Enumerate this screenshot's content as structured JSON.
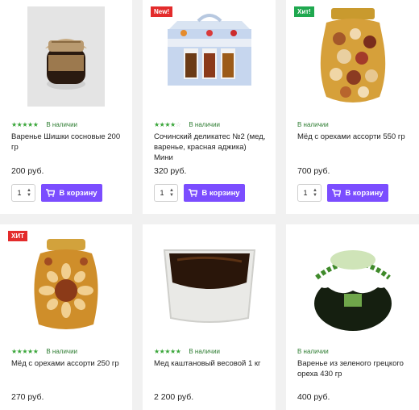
{
  "colors": {
    "accent": "#7b4dff",
    "badge_new": "#e32b2b",
    "badge_hit_green": "#1fa84f",
    "stock": "#2e7d32",
    "star_on": "#3aa63a"
  },
  "products": [
    {
      "badge": "",
      "rating": 5,
      "stock": "В наличии",
      "title": "Варенье Шишки сосновые 200 гр",
      "price": "200 руб.",
      "qty": "1",
      "cart_label": "В корзину",
      "image": "jar-pine-cones"
    },
    {
      "badge": "New!",
      "rating": 4,
      "stock": "В наличии",
      "title": "Сочинский деликатес №2 (мед, варенье, красная аджика) Мини",
      "price": "320 руб.",
      "qty": "1",
      "cart_label": "В корзину",
      "image": "gift-box-three-jars"
    },
    {
      "badge": "Хит!",
      "rating": 0,
      "stock": "В наличии",
      "title": "Мёд с орехами ассорти 550 гр",
      "price": "700 руб.",
      "qty": "1",
      "cart_label": "В корзину",
      "image": "jar-honey-nuts-large"
    },
    {
      "badge": "ХИТ",
      "rating": 5,
      "stock": "В наличии",
      "title": "Мёд с орехами ассорти 250 гр",
      "price": "270 руб.",
      "image": "jar-honey-nuts-small"
    },
    {
      "badge": "",
      "rating": 5,
      "stock": "В наличии",
      "title": "Мед каштановый весовой 1 кг",
      "price": "2 200 руб.",
      "image": "tub-chestnut-honey"
    },
    {
      "badge": "",
      "rating": 0,
      "stock": "В наличии",
      "title": "Варенье из зеленого грецкого ореха 430 гр",
      "price": "400 руб.",
      "image": "jar-green-walnut"
    }
  ]
}
